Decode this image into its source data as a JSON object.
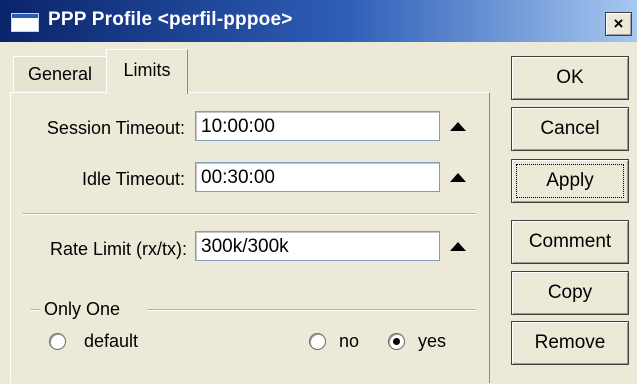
{
  "window": {
    "title": "PPP Profile <perfil-pppoe>",
    "close_glyph": "×"
  },
  "tabs": [
    {
      "label": "General",
      "active": false
    },
    {
      "label": "Limits",
      "active": true
    }
  ],
  "fields": {
    "session_timeout": {
      "label": "Session Timeout:",
      "value": "10:00:00"
    },
    "idle_timeout": {
      "label": "Idle Timeout:",
      "value": "00:30:00"
    },
    "rate_limit": {
      "label": "Rate Limit (rx/tx):",
      "value": "300k/300k"
    }
  },
  "only_one": {
    "group_label": "Only One",
    "options": [
      {
        "label": "default",
        "checked": false
      },
      {
        "label": "no",
        "checked": false
      },
      {
        "label": "yes",
        "checked": true
      }
    ]
  },
  "buttons": {
    "ok": "OK",
    "cancel": "Cancel",
    "apply": "Apply",
    "comment": "Comment",
    "copy": "Copy",
    "remove": "Remove"
  },
  "icons": {
    "window": "window-icon",
    "close": "close-icon",
    "collapse": "triangle-up-icon"
  }
}
